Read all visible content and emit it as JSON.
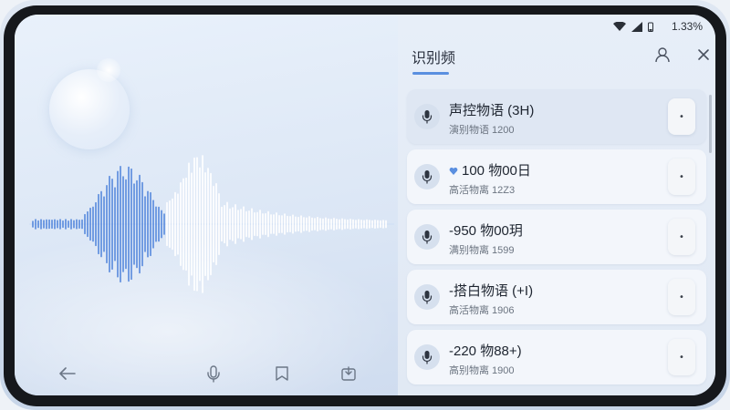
{
  "status": {
    "battery_text": "1.33%"
  },
  "panel": {
    "title": "识别频"
  },
  "items": [
    {
      "title": "声控物语 (3H)",
      "subtitle": "演别物语 1200"
    },
    {
      "title": "100 物00日",
      "subtitle": "高活物离 12Z3"
    },
    {
      "title": "-950 物00玥",
      "subtitle": "满别物离 1599"
    },
    {
      "title": "-搭白物语 (+I)",
      "subtitle": "高活物离 1906"
    },
    {
      "title": "-220 物88+)",
      "subtitle": "高别物离 1900"
    }
  ],
  "icons": {
    "back": "back-arrow-icon",
    "mic": "microphone-icon",
    "bookmark": "bookmark-icon",
    "share": "share-icon",
    "profile": "profile-icon",
    "close": "close-icon",
    "more": "more-dot-icon",
    "heart": "heart-icon",
    "wifi": "wifi-icon",
    "signal": "signal-icon",
    "battery": "battery-icon"
  },
  "colors": {
    "accent": "#5a8fe0",
    "wave_primary": "#3f78d8",
    "wave_secondary": "#ffffff"
  }
}
